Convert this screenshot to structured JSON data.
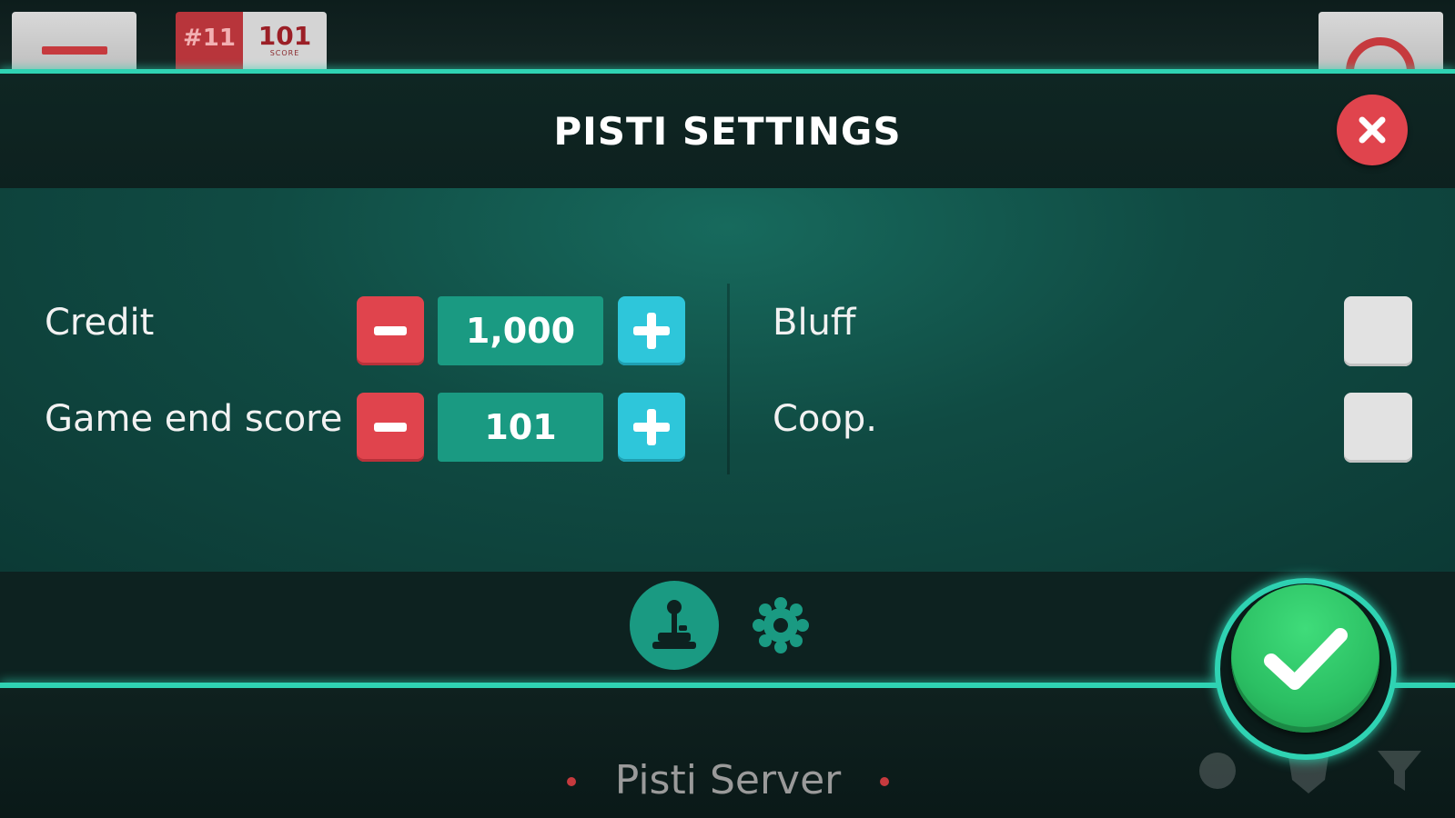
{
  "topbar": {
    "rank": "#11",
    "score": "101",
    "score_label": "SCORE",
    "menu_icon": "hamburger-icon",
    "right_icon": "ring-icon"
  },
  "modal": {
    "title": "PISTI SETTINGS",
    "close_icon": "close-icon",
    "settings": [
      {
        "label": "Credit",
        "value": "1,000"
      },
      {
        "label": "Game end score",
        "value": "101"
      }
    ],
    "toggles": [
      {
        "label": "Bluff",
        "checked": false
      },
      {
        "label": "Coop.",
        "checked": false
      }
    ],
    "tabs": [
      {
        "name": "game-settings",
        "icon": "joystick-icon",
        "active": true
      },
      {
        "name": "rules-settings",
        "icon": "gear-icon",
        "active": false
      }
    ],
    "confirm_icon": "checkmark-icon"
  },
  "bottombar": {
    "server": "Pisti Server"
  },
  "colors": {
    "accent": "#2fd3b3",
    "red": "#e0444d",
    "blue": "#2ec6da",
    "green": "#2bbf63",
    "value_bg": "#1a9a82"
  }
}
